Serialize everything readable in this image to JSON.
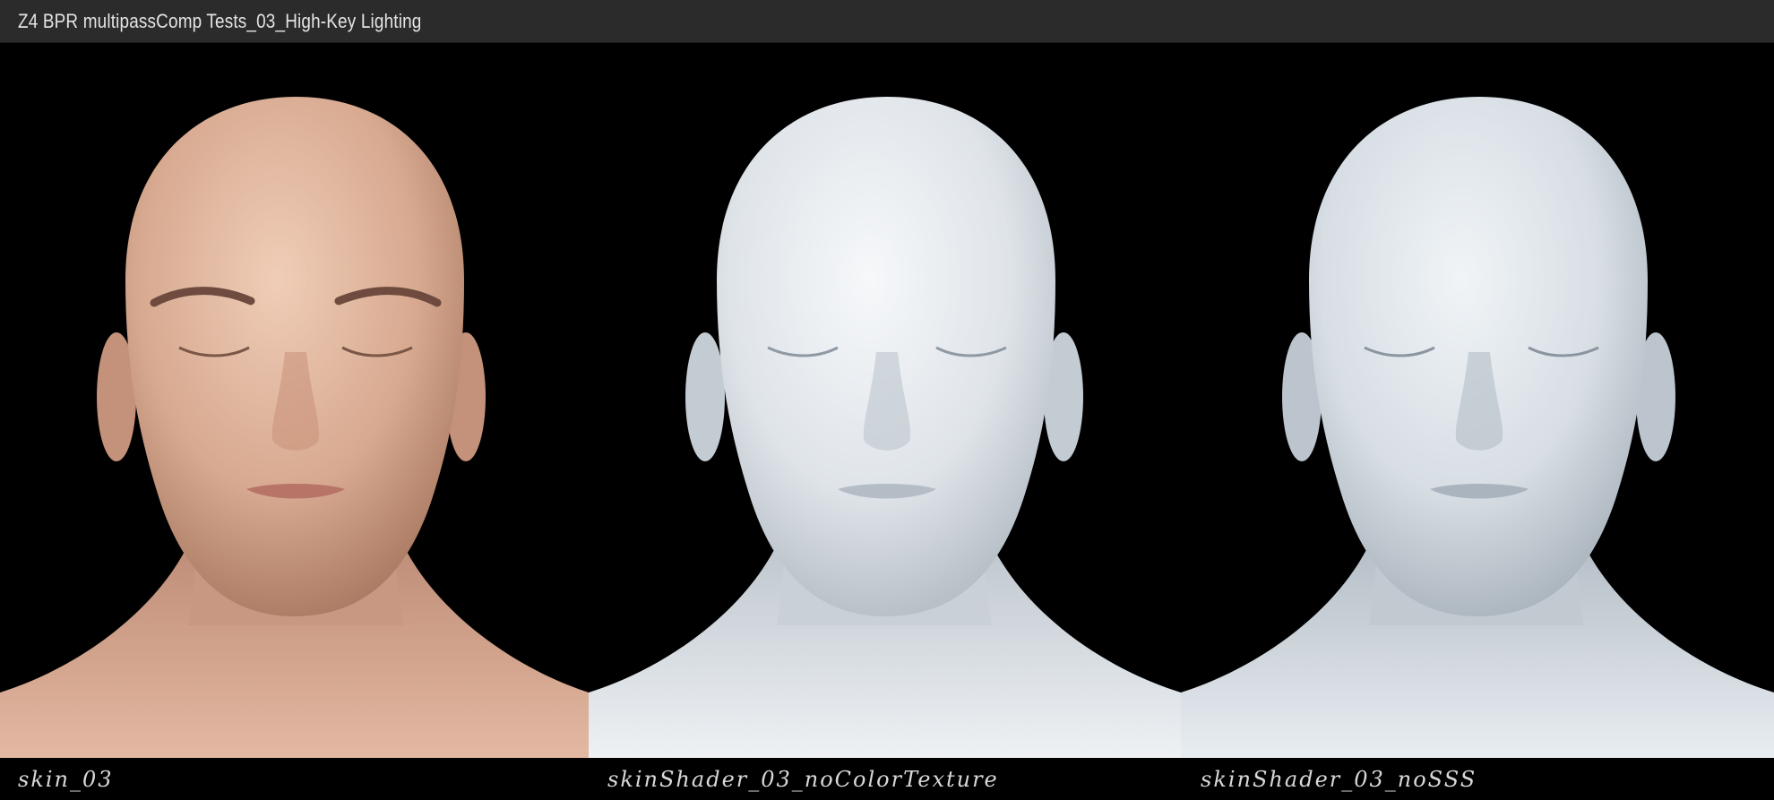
{
  "window": {
    "title": "Z4 BPR multipassComp Tests_03_High-Key Lighting"
  },
  "panels": [
    {
      "caption": "skin_03",
      "tone": "skin"
    },
    {
      "caption": "skinShader_03_noColorTexture",
      "tone": "shader-white"
    },
    {
      "caption": "skinShader_03_noSSS",
      "tone": "shader-gray"
    }
  ],
  "colors": {
    "background": "#000000",
    "titlebar": "#2b2b2b",
    "skin_light": "#ecc6ae",
    "skin_dark": "#9d6c56",
    "shader_white_light": "#f4f6f8",
    "shader_white_dark": "#a9b2bb",
    "shader_gray_light": "#eef2f5",
    "shader_gray_dark": "#9ea8b2"
  }
}
